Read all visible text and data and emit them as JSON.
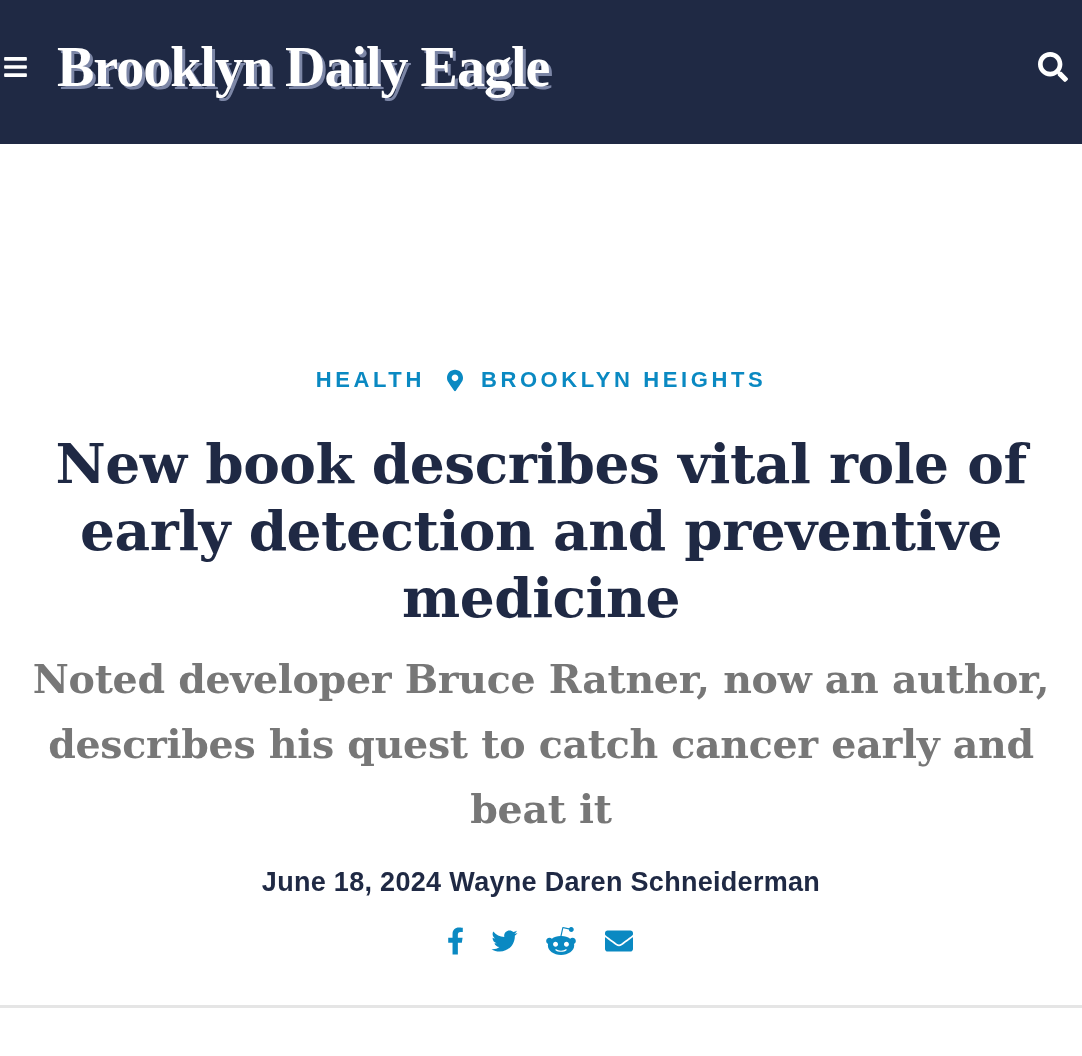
{
  "header": {
    "logo": "Brooklyn Daily Eagle"
  },
  "article": {
    "categories": [
      {
        "label": "HEALTH",
        "kind": "section"
      },
      {
        "label": "BROOKLYN HEIGHTS",
        "kind": "location"
      }
    ],
    "headline": "New book describes vital role of early detection and preventive medicine",
    "subtitle": "Noted developer Bruce Ratner, now an author, describes his quest to catch cancer early and beat it",
    "byline": {
      "date": "June 18, 2024",
      "author": "Wayne Daren Schneiderman"
    },
    "share": [
      {
        "kind": "facebook"
      },
      {
        "kind": "twitter"
      },
      {
        "kind": "reddit"
      },
      {
        "kind": "email"
      }
    ]
  }
}
